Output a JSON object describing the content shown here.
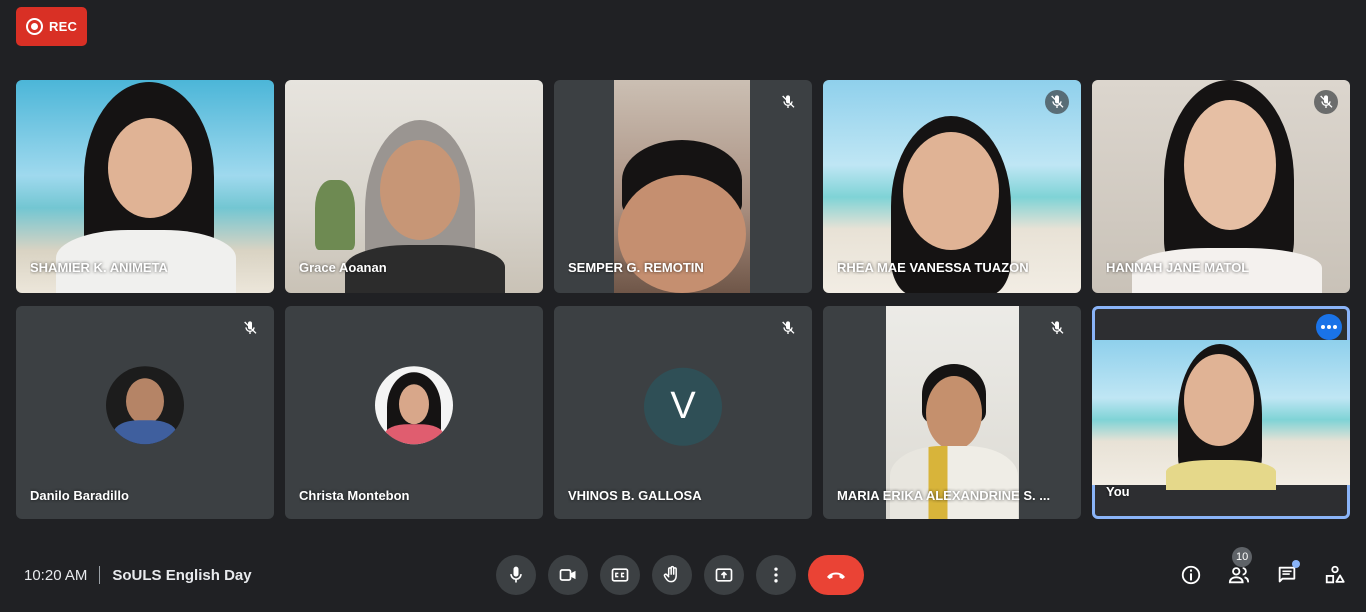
{
  "recording": {
    "label": "REC"
  },
  "participants": [
    {
      "name": "SHAMIER K. ANIMETA",
      "muted": false
    },
    {
      "name": "Grace Aoanan",
      "muted": false
    },
    {
      "name": "SEMPER G. REMOTIN",
      "muted": true
    },
    {
      "name": "RHEA MAE VANESSA TUAZON",
      "muted": true
    },
    {
      "name": "HANNAH JANE MATOL",
      "muted": true
    },
    {
      "name": "Danilo Baradillo",
      "muted": true
    },
    {
      "name": "Christa Montebon",
      "muted": false
    },
    {
      "name": "VHINOS B. GALLOSA",
      "muted": true,
      "initial": "V"
    },
    {
      "name": "MARIA ERIKA ALEXANDRINE S. ...",
      "muted": true
    },
    {
      "name": "You",
      "muted": false
    }
  ],
  "footer": {
    "time": "10:20 AM",
    "meeting_title": "SoULS English Day",
    "participant_count": "10"
  },
  "controls": [
    "mic-icon",
    "camera-icon",
    "captions-icon",
    "raise-hand-icon",
    "present-icon",
    "more-options-icon",
    "hang-up-icon"
  ],
  "right_controls": [
    "info-icon",
    "people-icon",
    "chat-icon",
    "activities-icon"
  ],
  "colors": {
    "background": "#202124",
    "tile": "#3c4043",
    "record": "#d93025",
    "hangup": "#ea4335",
    "accent": "#8ab4f8"
  }
}
